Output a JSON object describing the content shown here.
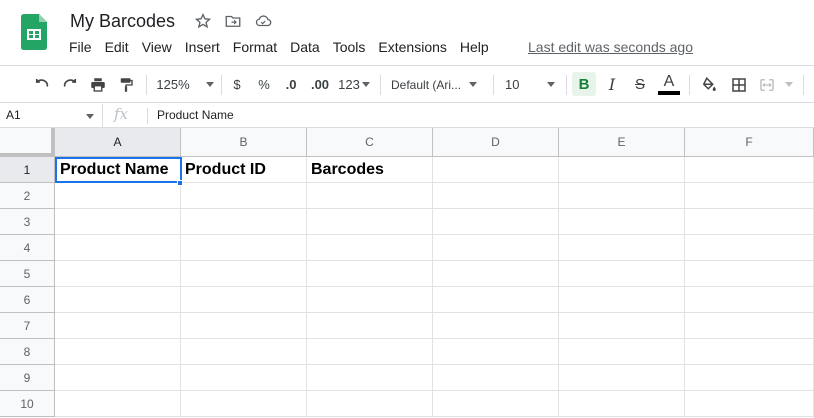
{
  "app": {
    "title": "My Barcodes",
    "last_edit": "Last edit was seconds ago",
    "menu": [
      "File",
      "Edit",
      "View",
      "Insert",
      "Format",
      "Data",
      "Tools",
      "Extensions",
      "Help"
    ]
  },
  "toolbar": {
    "zoom": "125%",
    "currency": "$",
    "percent": "%",
    "decrease_decimal": ".0",
    "increase_decimal": ".00",
    "more_formats": "123",
    "font": "Default (Ari...",
    "font_size": "10",
    "bold": "B",
    "italic": "I",
    "strikethrough": "S",
    "text_color": "A",
    "accent_color": "#188038"
  },
  "formula_bar": {
    "cell_ref": "A1",
    "fx": "fx",
    "value": "Product Name"
  },
  "sheet": {
    "columns": [
      "A",
      "B",
      "C",
      "D",
      "E",
      "F"
    ],
    "rows": [
      "1",
      "2",
      "3",
      "4",
      "5",
      "6",
      "7",
      "8",
      "9",
      "10"
    ],
    "cells": {
      "A1": "Product Name",
      "B1": "Product ID",
      "C1": "Barcodes"
    }
  }
}
